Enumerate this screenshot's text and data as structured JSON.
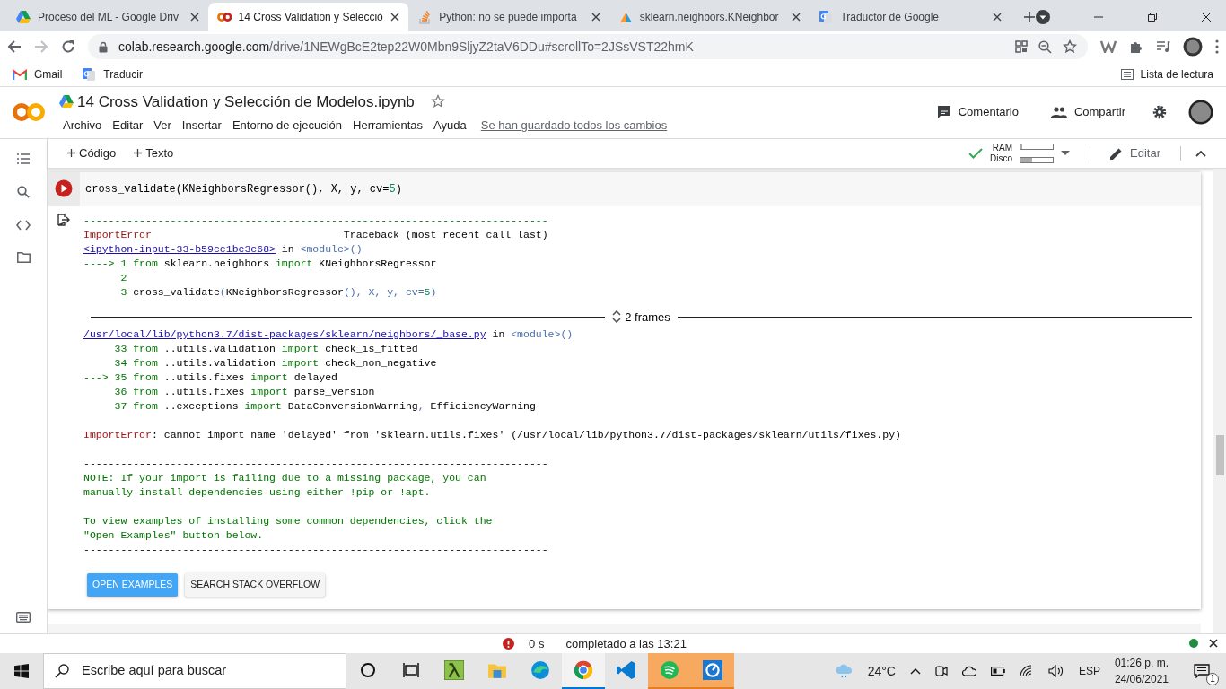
{
  "browser": {
    "tabs": [
      {
        "title": "Proceso del ML - Google Driv",
        "selected": false
      },
      {
        "title": "14 Cross Validation y Selecció",
        "selected": true
      },
      {
        "title": "Python: no se puede importa",
        "selected": false
      },
      {
        "title": "sklearn.neighbors.KNeighbor",
        "selected": false
      },
      {
        "title": "Traductor de Google",
        "selected": false
      }
    ],
    "address": {
      "host": "colab.research.google.com",
      "path": "/drive/1NEWgBcE2tep22W0Mbn9SljyZ2taV6DDu#scrollTo=2JSsVST22hmK"
    },
    "bookmarks": [
      "Gmail",
      "Traducir"
    ],
    "reading_list": "Lista de lectura"
  },
  "notebook": {
    "title": "14 Cross Validation y Selección de Modelos.ipynb",
    "starred": false,
    "menu": [
      "Archivo",
      "Editar",
      "Ver",
      "Insertar",
      "Entorno de ejecución",
      "Herramientas",
      "Ayuda"
    ],
    "save_status": "Se han guardado todos los cambios",
    "actions": [
      "Comentario",
      "Compartir"
    ]
  },
  "toolbar": {
    "add_buttons": [
      "Código",
      "Texto"
    ],
    "connected": true,
    "resources": [
      {
        "label": "RAM",
        "level": 0.05
      },
      {
        "label": "Disco",
        "level": 0.35
      }
    ],
    "edit_label": "Editar"
  },
  "cell": {
    "code": [
      {
        "kind": "plain",
        "text": "cross_validate(KNeighborsRegressor(), X, y, cv="
      },
      {
        "kind": "number",
        "text": "5"
      },
      {
        "kind": "plain",
        "text": ")"
      }
    ],
    "output": {
      "blocks": [
        {
          "lines": [
            [
              {
                "kind": "green",
                "text": "---------------------------------------------------------------------------"
              }
            ],
            [
              {
                "kind": "error",
                "text": "ImportError"
              },
              {
                "kind": "plain",
                "text": "                               Traceback (most recent call last)"
              }
            ],
            [
              {
                "kind": "link",
                "text": "<ipython-input-33-b59cc1be3c68>"
              },
              {
                "kind": "plain",
                "text": " in "
              },
              {
                "kind": "module",
                "text": "<module>()"
              }
            ],
            [
              {
                "kind": "green",
                "text": "----> 1 from"
              },
              {
                "kind": "plain",
                "text": " sklearn"
              },
              {
                "kind": "plain",
                "text": ".neighbors "
              },
              {
                "kind": "green",
                "text": "import"
              },
              {
                "kind": "plain",
                "text": " KNeighborsRegressor"
              }
            ],
            [
              {
                "kind": "green",
                "text": "      2"
              }
            ],
            [
              {
                "kind": "green",
                "text": "      3"
              },
              {
                "kind": "plain",
                "text": " cross_validate"
              },
              {
                "kind": "module",
                "text": "("
              },
              {
                "kind": "plain",
                "text": "KNeighborsRegressor"
              },
              {
                "kind": "module",
                "text": "(), X, y, cv="
              },
              {
                "kind": "number",
                "text": "5"
              },
              {
                "kind": "module",
                "text": ")"
              }
            ]
          ]
        },
        {
          "frames": "2 frames"
        },
        {
          "lines": [
            [
              {
                "kind": "link",
                "text": "/usr/local/lib/python3.7/dist-packages/sklearn/neighbors/_base.py"
              },
              {
                "kind": "plain",
                "text": " in "
              },
              {
                "kind": "module",
                "text": "<module>()"
              }
            ],
            [
              {
                "kind": "green",
                "text": "     33 from"
              },
              {
                "kind": "plain",
                "text": " ..utils.validation "
              },
              {
                "kind": "green",
                "text": "import"
              },
              {
                "kind": "plain",
                "text": " check_is_fitted"
              }
            ],
            [
              {
                "kind": "green",
                "text": "     34 from"
              },
              {
                "kind": "plain",
                "text": " ..utils.validation "
              },
              {
                "kind": "green",
                "text": "import"
              },
              {
                "kind": "plain",
                "text": " check_non_negative"
              }
            ],
            [
              {
                "kind": "green",
                "text": "---> 35 from"
              },
              {
                "kind": "plain",
                "text": " ..utils.fixes "
              },
              {
                "kind": "green",
                "text": "import"
              },
              {
                "kind": "plain",
                "text": " delayed"
              }
            ],
            [
              {
                "kind": "green",
                "text": "     36 from"
              },
              {
                "kind": "plain",
                "text": " ..utils.fixes "
              },
              {
                "kind": "green",
                "text": "import"
              },
              {
                "kind": "plain",
                "text": " parse_version"
              }
            ],
            [
              {
                "kind": "green",
                "text": "     37 from"
              },
              {
                "kind": "plain",
                "text": " ..exceptions "
              },
              {
                "kind": "green",
                "text": "import"
              },
              {
                "kind": "plain",
                "text": " DataConversionWarning"
              },
              {
                "kind": "module",
                "text": ","
              },
              {
                "kind": "plain",
                "text": " EfficiencyWarning"
              }
            ]
          ]
        },
        {
          "lines": [
            [
              {
                "kind": "error",
                "text": "ImportError"
              },
              {
                "kind": "plain",
                "text": ": cannot import name 'delayed' from 'sklearn.utils.fixes' (/usr/local/lib/python3.7/dist-packages/sklearn/utils/fixes.py)"
              }
            ]
          ]
        },
        {
          "lines": [
            [
              {
                "kind": "plain",
                "text": "---------------------------------------------------------------------------"
              }
            ],
            [
              {
                "kind": "green",
                "text": "NOTE: If your import is failing due to a missing package, you can"
              }
            ],
            [
              {
                "kind": "green",
                "text": "manually install dependencies using either !pip or !apt."
              }
            ]
          ]
        },
        {
          "lines": [
            [
              {
                "kind": "green",
                "text": "To view examples of installing some common dependencies, click the"
              }
            ],
            [
              {
                "kind": "green",
                "text": "\"Open Examples\" button below."
              }
            ],
            [
              {
                "kind": "plain",
                "text": "---------------------------------------------------------------------------"
              }
            ]
          ]
        }
      ],
      "buttons": [
        {
          "label": "OPEN EXAMPLES",
          "primary": true
        },
        {
          "label": "SEARCH STACK OVERFLOW",
          "primary": false
        }
      ]
    }
  },
  "status_bar": {
    "error": true,
    "duration": "0 s",
    "message": "completado a las 13:21",
    "connected": true
  },
  "taskbar": {
    "search": {
      "placeholder": "Escribe aquí para buscar"
    },
    "apps": [
      {
        "selected": false,
        "flashing": false
      },
      {
        "selected": false,
        "flashing": false
      },
      {
        "selected": false,
        "flashing": false
      },
      {
        "selected": true,
        "flashing": false
      },
      {
        "selected": false,
        "flashing": false
      },
      {
        "selected": false,
        "flashing": true
      },
      {
        "selected": false,
        "flashing": true
      }
    ],
    "weather": "24°C",
    "language": "ESP",
    "time": "01:26 p. m.",
    "date": "24/06/2021",
    "notifications": "1"
  }
}
